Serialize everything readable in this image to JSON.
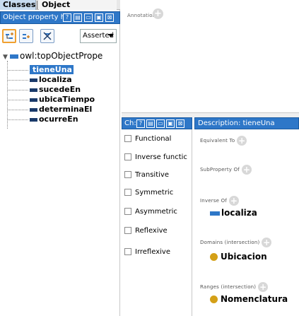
{
  "tabs": {
    "classes": "Classes",
    "object_properties": "Object properties"
  },
  "hierarchy_view": {
    "title": "Object property h",
    "buttons": [
      "?",
      "▤",
      "▭",
      "▣",
      "⊠"
    ]
  },
  "toolbar": {
    "filter_select": "Asserted"
  },
  "tree": {
    "root": "owl:topObjectPrope",
    "items": [
      {
        "label": "tieneUna",
        "selected": true
      },
      {
        "label": "localiza",
        "selected": false
      },
      {
        "label": "sucedeEn",
        "selected": false
      },
      {
        "label": "ubicaTiempo",
        "selected": false
      },
      {
        "label": "determinaEl",
        "selected": false
      },
      {
        "label": "ocurreEn",
        "selected": false
      }
    ]
  },
  "annotations": {
    "label": "Annotations"
  },
  "characteristics": {
    "title": "Ch:",
    "buttons": [
      "?",
      "▤",
      "▭",
      "▣",
      "⊠"
    ],
    "items": [
      "Functional",
      "Inverse functic",
      "Transitive",
      "Symmetric",
      "Asymmetric",
      "Reflexive",
      "Irreflexive"
    ]
  },
  "description": {
    "title": "Description: tieneUna",
    "equivalent_to": "Equivalent To",
    "subproperty_of": "SubProperty Of",
    "inverse_of": "Inverse Of",
    "inverse_value": "localiza",
    "domains": "Domains (intersection)",
    "domain_value": "Ubicacion",
    "ranges": "Ranges (intersection)",
    "range_value": "Nomenclatura"
  },
  "colors": {
    "accent": "#2e77c8",
    "class_dot": "#d4a017"
  }
}
